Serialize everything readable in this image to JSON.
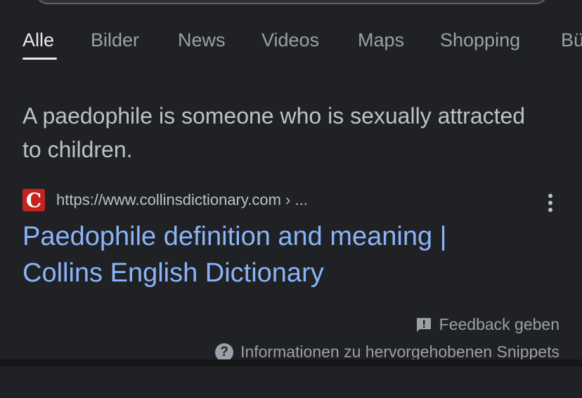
{
  "tabs": [
    {
      "label": "Alle",
      "active": true
    },
    {
      "label": "Bilder",
      "active": false
    },
    {
      "label": "News",
      "active": false
    },
    {
      "label": "Videos",
      "active": false
    },
    {
      "label": "Maps",
      "active": false
    },
    {
      "label": "Shopping",
      "active": false
    },
    {
      "label": "Bü",
      "active": false
    }
  ],
  "featured_snippet": {
    "text": "A paedophile is someone who is sexually attracted to children."
  },
  "result": {
    "favicon_letter": "C",
    "favicon_color": "#c5221f",
    "url": "https://www.collinsdictionary.com › ...",
    "title": "Paedophile definition and meaning | Collins English Dictionary",
    "more_icon": "more-vert-icon"
  },
  "footer": {
    "feedback_label": "Feedback geben",
    "info_label": "Informationen zu hervorgehobenen Snippets",
    "help_glyph": "?"
  },
  "colors": {
    "background": "#202124",
    "link": "#8ab4f8",
    "text": "#bdc1c6",
    "muted": "#9aa0a6"
  }
}
